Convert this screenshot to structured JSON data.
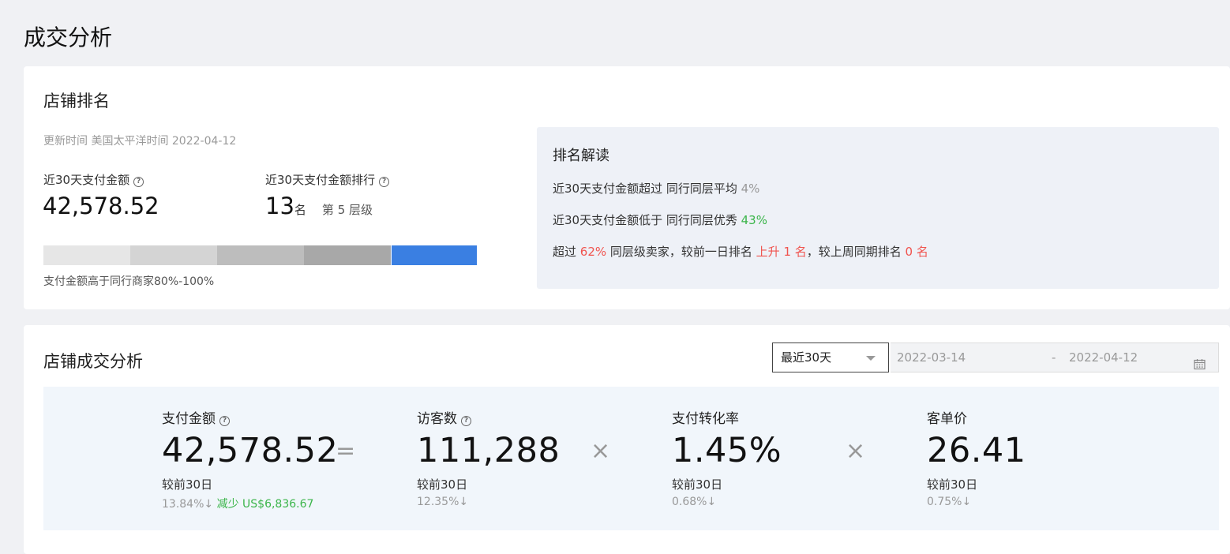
{
  "page": {
    "title": "成交分析"
  },
  "ranking": {
    "title": "店铺排名",
    "update_time": "更新时间 美国太平洋时间 2022-04-12",
    "metric1": {
      "label": "近30天支付金额",
      "value": "42,578.52"
    },
    "metric2": {
      "label": "近30天支付金额排行",
      "value": "13",
      "unit": "名",
      "tier": "第 5 层级"
    },
    "bar": {
      "segment_colors": [
        "#e6e6e6",
        "#d4d4d4",
        "#bdbdbd",
        "#a8a8a8",
        "#3a7fe2"
      ],
      "active_segment": 5,
      "caption": "支付金额高于同行商家80%-100%"
    },
    "interpretation": {
      "title": "排名解读",
      "line1": {
        "text": "近30天支付金额超过 同行同层平均 ",
        "value": "4%"
      },
      "line2": {
        "text": "近30天支付金额低于 同行同层优秀 ",
        "value": "43%"
      },
      "line3": {
        "p1": "超过 ",
        "v1": "62%",
        "p2": " 同层级卖家，较前一日排名 ",
        "v2": "上升 1 名",
        "p3": "，较上周同期排名 ",
        "v3": "0 名"
      }
    }
  },
  "analysis": {
    "title": "店铺成交分析",
    "period_select": "最近30天",
    "date_start": "2022-03-14",
    "date_sep": "-",
    "date_end": "2022-04-12",
    "operators": [
      "=",
      "×",
      "×"
    ],
    "metrics": [
      {
        "label": "支付金额",
        "value": "42,578.52",
        "compare": "较前30日",
        "change": "13.84%↓",
        "extra": "减少 US$6,836.67"
      },
      {
        "label": "访客数",
        "value": "111,288",
        "compare": "较前30日",
        "change": "12.35%↓"
      },
      {
        "label": "支付转化率",
        "value": "1.45%",
        "compare": "较前30日",
        "change": "0.68%↓"
      },
      {
        "label": "客单价",
        "value": "26.41",
        "compare": "较前30日",
        "change": "0.75%↓"
      }
    ]
  },
  "colors": {
    "accent_blue": "#3a7fe2",
    "up_red": "#f0544f",
    "down_green": "#3bb54a"
  },
  "icons": [
    "help-icon",
    "chevron-down-icon",
    "calendar-icon"
  ]
}
